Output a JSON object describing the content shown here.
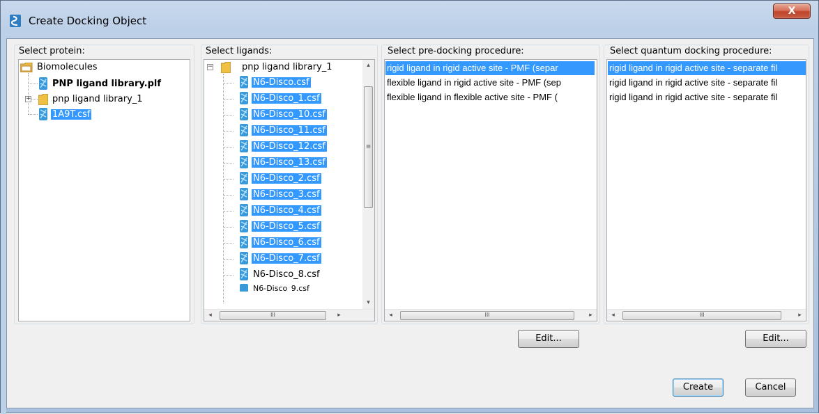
{
  "window": {
    "title": "Create Docking Object",
    "close_glyph": "X"
  },
  "protein_panel": {
    "label": "Select protein:",
    "root": "Biomolecules",
    "items": [
      {
        "label": "PNP ligand library.plf",
        "bold": true,
        "selected": false
      },
      {
        "label": "pnp ligand library_1",
        "bold": false,
        "selected": false,
        "folder": true
      },
      {
        "label": "1A9T.csf",
        "bold": false,
        "selected": true
      }
    ]
  },
  "ligand_panel": {
    "label": "Select ligands:",
    "root": "pnp ligand library_1",
    "items": [
      {
        "label": "N6-Disco.csf",
        "selected": true
      },
      {
        "label": "N6-Disco_1.csf",
        "selected": true
      },
      {
        "label": "N6-Disco_10.csf",
        "selected": true
      },
      {
        "label": "N6-Disco_11.csf",
        "selected": true
      },
      {
        "label": "N6-Disco_12.csf",
        "selected": true
      },
      {
        "label": "N6-Disco_13.csf",
        "selected": true
      },
      {
        "label": "N6-Disco_2.csf",
        "selected": true
      },
      {
        "label": "N6-Disco_3.csf",
        "selected": true
      },
      {
        "label": "N6-Disco_4.csf",
        "selected": true
      },
      {
        "label": "N6-Disco_5.csf",
        "selected": true
      },
      {
        "label": "N6-Disco_6.csf",
        "selected": true
      },
      {
        "label": "N6-Disco_7.csf",
        "selected": true
      },
      {
        "label": "N6-Disco_8.csf",
        "selected": false
      },
      {
        "label": "N6-Disco_9.csf",
        "selected": false
      }
    ]
  },
  "predocking_panel": {
    "label": "Select pre-docking procedure:",
    "items": [
      {
        "label": "rigid ligand in rigid active site - PMF (separ",
        "selected": true
      },
      {
        "label": "flexible ligand in rigid active site - PMF (sep",
        "selected": false
      },
      {
        "label": "flexible ligand in flexible active site - PMF (",
        "selected": false
      }
    ],
    "edit_label": "Edit..."
  },
  "quantum_panel": {
    "label": "Select quantum docking procedure:",
    "items": [
      {
        "label": "rigid ligand in rigid active site - separate fil",
        "selected": true
      },
      {
        "label": "rigid ligand in rigid active site - separate fil",
        "selected": false
      },
      {
        "label": "rigid ligand in rigid active site - separate fil",
        "selected": false
      }
    ],
    "edit_label": "Edit..."
  },
  "scrollbar": {
    "left_arrow": "◂",
    "right_arrow": "▸",
    "up_arrow": "▴",
    "down_arrow": "▾",
    "grip": "III",
    "grip_v": "≡"
  },
  "expander": {
    "collapsed": "+",
    "expanded": "−"
  },
  "actions": {
    "create_label": "Create",
    "cancel_label": "Cancel"
  },
  "colors": {
    "selection": "#3399ff",
    "folder": "#f0c040",
    "molecule": "#3a9ad9"
  },
  "icons": {
    "app": "app-logo-icon",
    "folder": "folder-icon",
    "molecule": "molecule-file-icon",
    "close": "close-icon"
  }
}
